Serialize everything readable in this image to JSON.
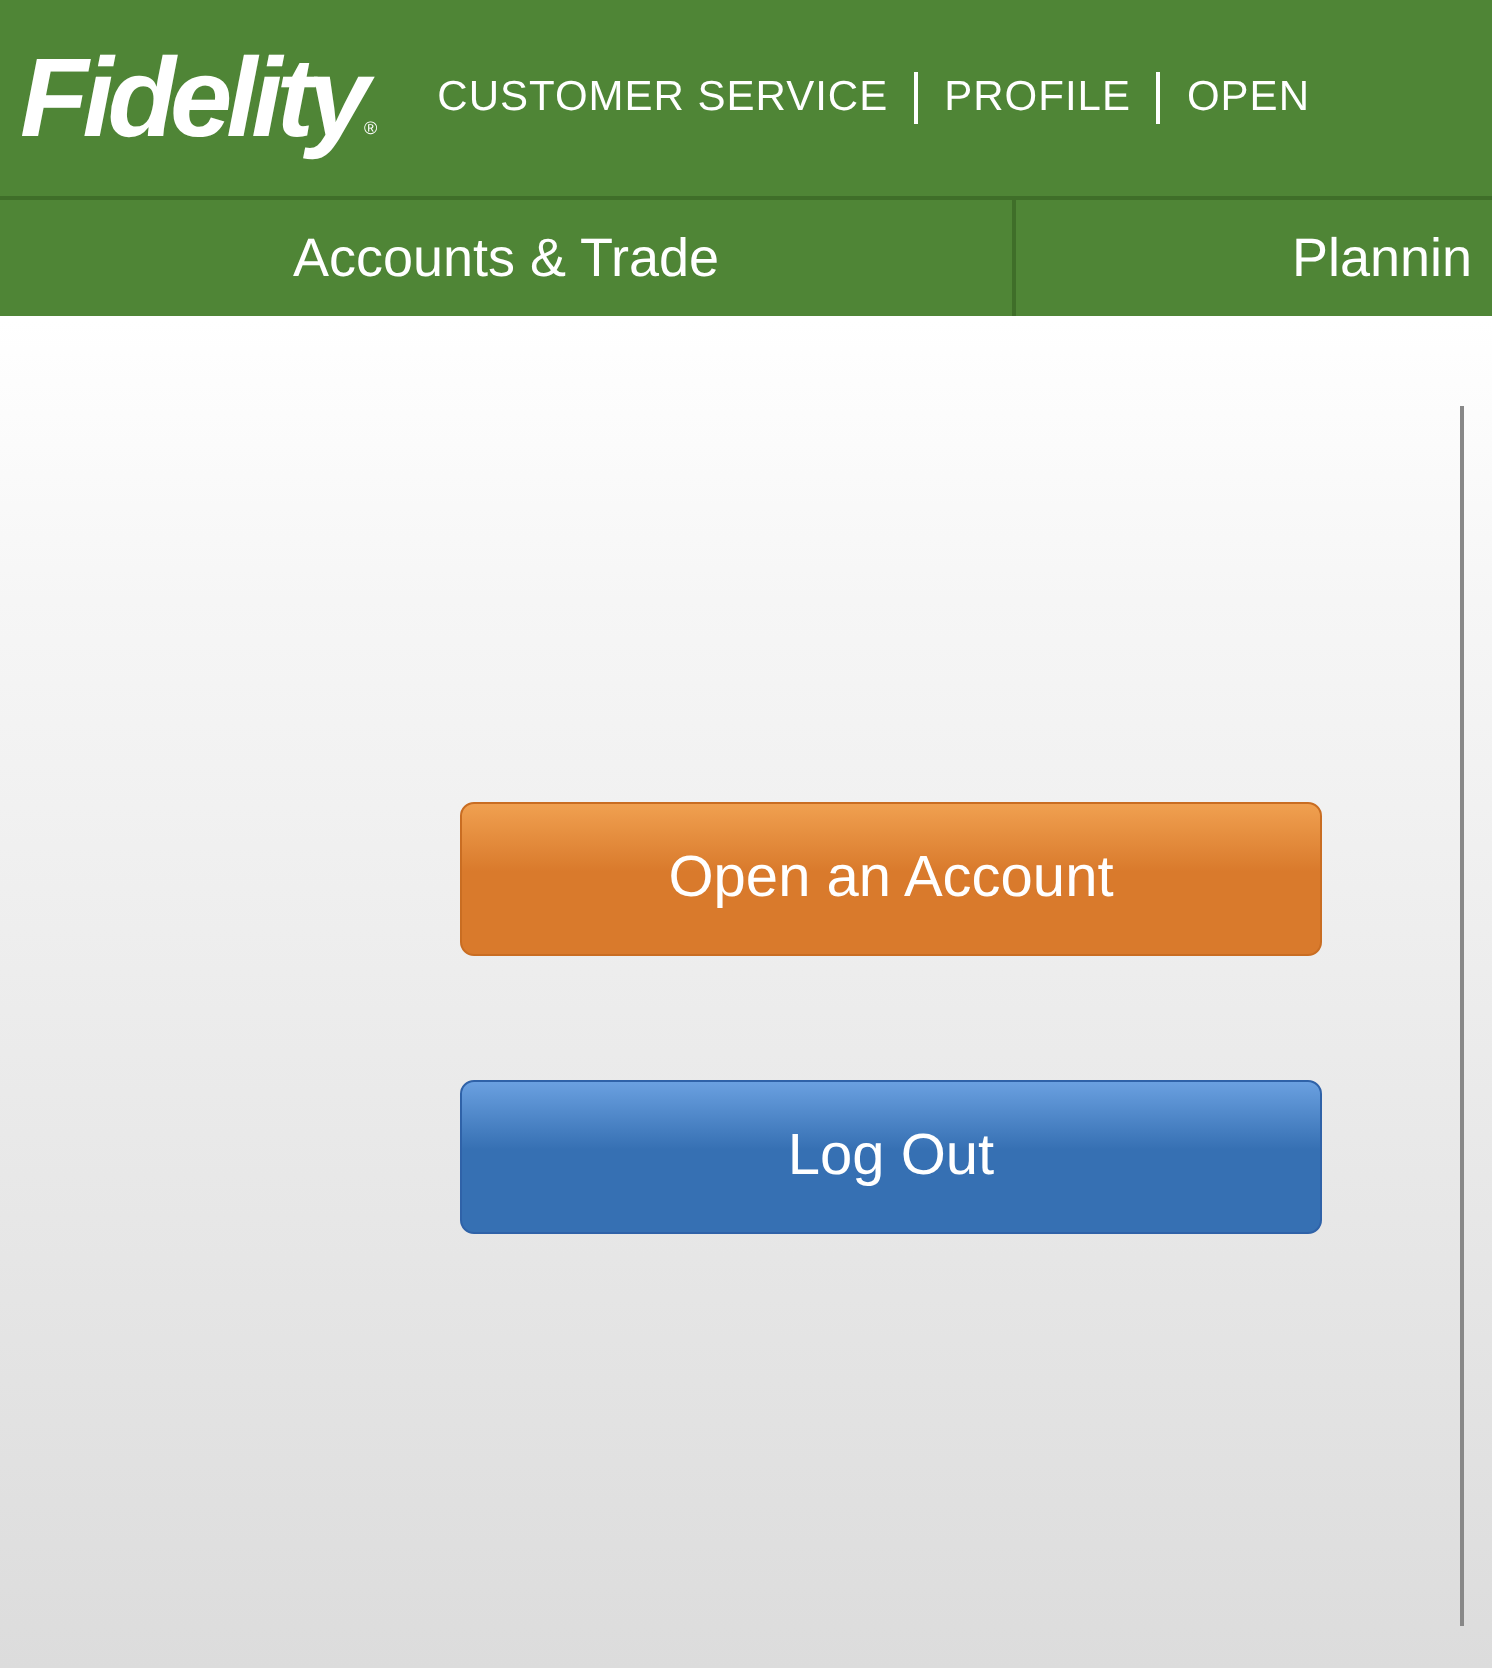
{
  "header": {
    "logo": "Fidelity",
    "logo_mark": "®",
    "links": [
      "CUSTOMER SERVICE",
      "PROFILE",
      "OPEN"
    ]
  },
  "nav": {
    "tabs": [
      "Accounts & Trade",
      "Plannin"
    ]
  },
  "buttons": [
    {
      "label": "Open an Account",
      "kind": "primary"
    },
    {
      "label": "Log Out",
      "kind": "secondary"
    }
  ]
}
